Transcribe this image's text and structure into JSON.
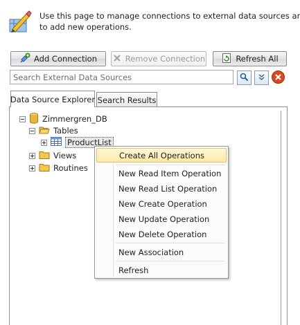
{
  "header": {
    "description": "Use this page to manage connections to external data sources and the",
    "description_line2": "to add new operations."
  },
  "toolbar": {
    "add_connection": "Add Connection",
    "remove_connection": "Remove Connection",
    "refresh_all": "Refresh All"
  },
  "search": {
    "placeholder": "Search External Data Sources"
  },
  "tabs": [
    {
      "label": "Data Source Explorer",
      "active": true
    },
    {
      "label": "Search Results",
      "active": false
    }
  ],
  "tree": {
    "root": "Zimmergren_DB",
    "tables": "Tables",
    "productlist": "ProductList",
    "views": "Views",
    "routines": "Routines"
  },
  "context_menu": {
    "items": [
      "Create All Operations",
      "New Read Item Operation",
      "New Read List Operation",
      "New Create Operation",
      "New Update Operation",
      "New Delete Operation",
      "New Association",
      "Refresh"
    ],
    "highlighted": "Create All Operations"
  },
  "colors": {
    "menu_highlight": "#fde9a6",
    "close_button": "#d9491c",
    "folder": "#f2c94c",
    "database": "#e8b739"
  },
  "icons": [
    "settings-tool-icon",
    "add-connection-icon",
    "remove-icon",
    "refresh-icon",
    "search-icon",
    "chevron-down-icon",
    "close-icon",
    "database-icon",
    "folder-icon",
    "table-icon"
  ]
}
